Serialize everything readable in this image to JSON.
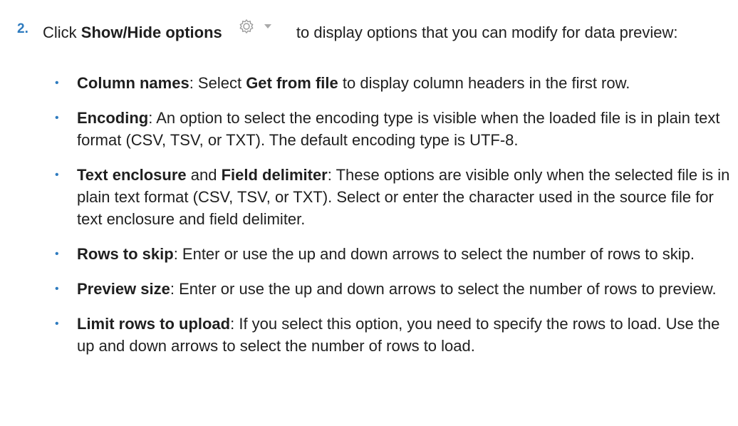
{
  "step": {
    "number": "2.",
    "intro_before": "Click ",
    "intro_bold": "Show/Hide options",
    "intro_after": " to display options that you can modify for data preview:",
    "icon": "gear-dropdown-icon"
  },
  "bullets": [
    {
      "term": "Column names",
      "text_1": ": Select ",
      "term_2": "Get from file",
      "text_2": " to display column headers in the first row."
    },
    {
      "term": "Encoding",
      "text_1": ": An option to select the encoding type is visible when the loaded file is in plain text format (CSV, TSV, or TXT). The default encoding type is UTF-8."
    },
    {
      "term": "Text enclosure",
      "text_1": " and ",
      "term_2": "Field delimiter",
      "text_2": ": These options are visible only when the selected file is in plain text format (CSV, TSV, or TXT). Select or enter the character used in the source file for text enclosure and field delimiter."
    },
    {
      "term": "Rows to skip",
      "text_1": ": Enter or use the up and down arrows to select the number of rows to skip."
    },
    {
      "term": "Preview size",
      "text_1": ": Enter or use the up and down arrows to select the number of rows to preview."
    },
    {
      "term": "Limit rows to upload",
      "text_1": ": If you select this option, you need to specify the rows to load. Use the up and down arrows to select the number of rows to load."
    }
  ],
  "colors": {
    "accent": "#2e7bbf",
    "text": "#1f1f1f"
  }
}
